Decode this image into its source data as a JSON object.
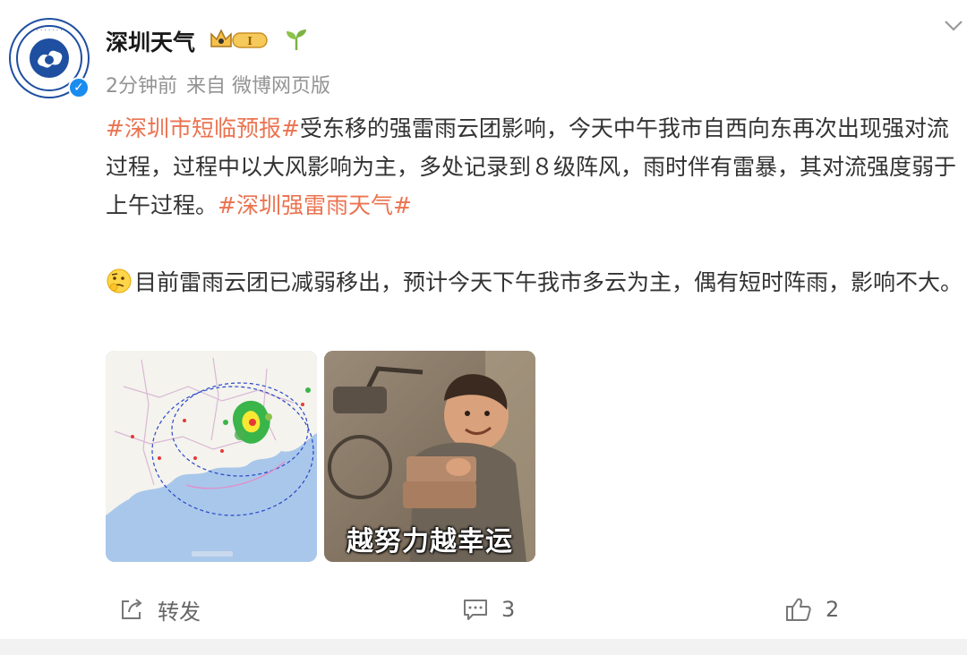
{
  "post": {
    "username": "深圳天气",
    "time": "2分钟前",
    "source": "来自 微博网页版",
    "tag1": "#深圳市短临预报#",
    "text1": "受东移的强雷雨云团影响，今天中午我市自西向东再次出现强对流过程，过程中以大风影响为主，多处记录到８级阵风，雨时伴有雷暴，其对流强度弱于上午过程。",
    "tag2": "#深圳强雷雨天气#",
    "text2": "目前雷雨云团已减弱移出，预计今天下午我市多云为主，偶有短时阵雨，影响不大。"
  },
  "images": {
    "meme_caption": "越努力越幸运"
  },
  "actions": {
    "repost_label": "转发",
    "comment_count": "3",
    "like_count": "2"
  },
  "colors": {
    "tag": "#eb7350",
    "meta": "#939393",
    "verified": "#1a8cf0"
  }
}
